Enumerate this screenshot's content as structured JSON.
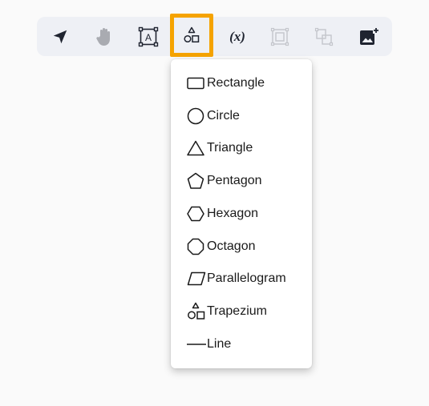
{
  "toolbar": {
    "tools": [
      {
        "id": "select",
        "icon": "navigation-arrow-icon"
      },
      {
        "id": "pan",
        "icon": "hand-icon"
      },
      {
        "id": "text",
        "icon": "text-box-icon",
        "glyph": "A"
      },
      {
        "id": "shapes",
        "icon": "shapes-icon",
        "active": true
      },
      {
        "id": "variable",
        "icon": "variable-icon",
        "glyph": "(x)"
      },
      {
        "id": "group",
        "icon": "group-icon"
      },
      {
        "id": "ungroup",
        "icon": "ungroup-icon"
      },
      {
        "id": "add-image",
        "icon": "add-image-icon"
      }
    ],
    "active_color": "#f5a300"
  },
  "shapes_menu": {
    "items": [
      {
        "label": "Rectangle",
        "icon": "rectangle-icon"
      },
      {
        "label": "Circle",
        "icon": "circle-icon"
      },
      {
        "label": "Triangle",
        "icon": "triangle-icon"
      },
      {
        "label": "Pentagon",
        "icon": "pentagon-icon"
      },
      {
        "label": "Hexagon",
        "icon": "hexagon-icon"
      },
      {
        "label": "Octagon",
        "icon": "octagon-icon"
      },
      {
        "label": "Parallelogram",
        "icon": "parallelogram-icon"
      },
      {
        "label": "Trapezium",
        "icon": "shapes-icon"
      },
      {
        "label": "Line",
        "icon": "line-icon"
      }
    ]
  }
}
